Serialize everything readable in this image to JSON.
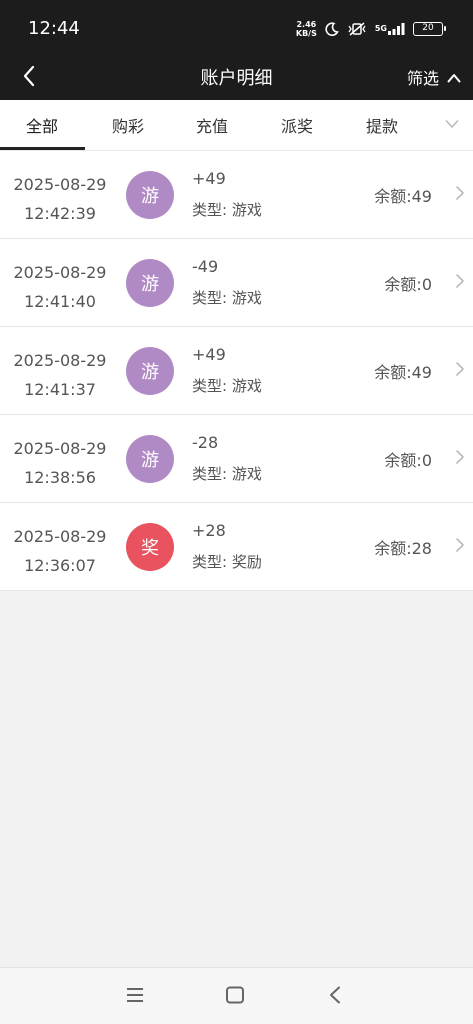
{
  "status": {
    "time": "12:44",
    "net_speed_value": "2.46",
    "net_speed_unit": "KB/S",
    "network": "5G",
    "battery": "20"
  },
  "header": {
    "title": "账户明细",
    "filter_label": "筛选"
  },
  "tabs": [
    {
      "label": "全部",
      "active": true
    },
    {
      "label": "购彩",
      "active": false
    },
    {
      "label": "充值",
      "active": false
    },
    {
      "label": "派奖",
      "active": false
    },
    {
      "label": "提款",
      "active": false
    }
  ],
  "records": [
    {
      "date": "2025-08-29",
      "time": "12:42:39",
      "badge": "游",
      "badge_color": "#b08ac4",
      "amount": "+49",
      "type": "类型: 游戏",
      "balance": "余额:49"
    },
    {
      "date": "2025-08-29",
      "time": "12:41:40",
      "badge": "游",
      "badge_color": "#b08ac4",
      "amount": "-49",
      "type": "类型: 游戏",
      "balance": "余额:0"
    },
    {
      "date": "2025-08-29",
      "time": "12:41:37",
      "badge": "游",
      "badge_color": "#b08ac4",
      "amount": "+49",
      "type": "类型: 游戏",
      "balance": "余额:49"
    },
    {
      "date": "2025-08-29",
      "time": "12:38:56",
      "badge": "游",
      "badge_color": "#b08ac4",
      "amount": "-28",
      "type": "类型: 游戏",
      "balance": "余额:0"
    },
    {
      "date": "2025-08-29",
      "time": "12:36:07",
      "badge": "奖",
      "badge_color": "#e8535f",
      "amount": "+28",
      "type": "类型: 奖励",
      "balance": "余额:28"
    }
  ],
  "icons": {
    "back": "back-icon",
    "filter": "chevron-up-icon",
    "tabs_more": "chevron-down-icon",
    "row": "chevron-right-icon",
    "bottom": [
      "menu-icon",
      "home-icon",
      "back-icon"
    ]
  }
}
